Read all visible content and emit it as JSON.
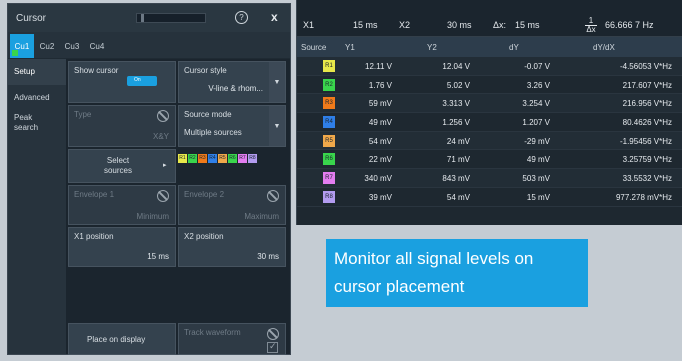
{
  "dialog": {
    "title": "Cursor",
    "help_icon": "?",
    "close_icon": "x",
    "tabs": [
      {
        "label": "Cu1"
      },
      {
        "label": "Cu2"
      },
      {
        "label": "Cu3"
      },
      {
        "label": "Cu4"
      }
    ],
    "side": [
      {
        "label": "Setup"
      },
      {
        "label": "Advanced"
      },
      {
        "label": "Peak search"
      }
    ],
    "show_cursor_label": "Show cursor",
    "show_cursor_state": "On",
    "cursor_style_label": "Cursor style",
    "cursor_style_value": "V-line & rhom...",
    "type_label": "Type",
    "type_value": "X&Y",
    "source_mode_label": "Source mode",
    "source_mode_value": "Multiple sources",
    "select_sources_label": "Select sources",
    "envelope1_label": "Envelope 1",
    "envelope1_value": "Minimum",
    "envelope2_label": "Envelope 2",
    "envelope2_value": "Maximum",
    "x1_label": "X1 position",
    "x1_value": "15 ms",
    "x2_label": "X2 position",
    "x2_value": "30 ms",
    "place_label": "Place on display",
    "track_label": "Track waveform",
    "chips": [
      {
        "t": "R1",
        "c": "#e8e84a"
      },
      {
        "t": "R2",
        "c": "#39d54c"
      },
      {
        "t": "R3",
        "c": "#f07a1a"
      },
      {
        "t": "R4",
        "c": "#2f7fe8"
      },
      {
        "t": "R5",
        "c": "#f0a84a"
      },
      {
        "t": "R6",
        "c": "#39d54c"
      },
      {
        "t": "R7",
        "c": "#e37df0"
      },
      {
        "t": "R8",
        "c": "#b39cf0"
      }
    ]
  },
  "results": {
    "x1_label": "X1",
    "x1_value": "15 ms",
    "x2_label": "X2",
    "x2_value": "30 ms",
    "dx_label": "Δx:",
    "dx_value": "15 ms",
    "inv_num": "1",
    "inv_den": "Δx",
    "inv_value": "66.666 7 Hz",
    "columns": [
      "Source",
      "Y1",
      "Y2",
      "dY",
      "dY/dX"
    ],
    "rows": [
      {
        "src": "R1",
        "color": "#e8e84a",
        "y1": "12.11 V",
        "y2": "12.04 V",
        "dy": "-0.07 V",
        "dydx": "-4.56053 V*Hz"
      },
      {
        "src": "R2",
        "color": "#39d54c",
        "y1": "1.76 V",
        "y2": "5.02 V",
        "dy": "3.26 V",
        "dydx": "217.607 V*Hz"
      },
      {
        "src": "R3",
        "color": "#f07a1a",
        "y1": "59 mV",
        "y2": "3.313 V",
        "dy": "3.254 V",
        "dydx": "216.956 V*Hz"
      },
      {
        "src": "R4",
        "color": "#2f7fe8",
        "y1": "49 mV",
        "y2": "1.256 V",
        "dy": "1.207 V",
        "dydx": "80.4626 V*Hz"
      },
      {
        "src": "R5",
        "color": "#f0a84a",
        "y1": "54 mV",
        "y2": "24 mV",
        "dy": "-29 mV",
        "dydx": "-1.95456 V*Hz"
      },
      {
        "src": "R6",
        "color": "#39d54c",
        "y1": "22 mV",
        "y2": "71 mV",
        "dy": "49 mV",
        "dydx": "3.25759 V*Hz"
      },
      {
        "src": "R7",
        "color": "#e37df0",
        "y1": "340 mV",
        "y2": "843 mV",
        "dy": "503 mV",
        "dydx": "33.5532 V*Hz"
      },
      {
        "src": "R8",
        "color": "#b39cf0",
        "y1": "39 mV",
        "y2": "54 mV",
        "dy": "15 mV",
        "dydx": "977.278 mV*Hz"
      }
    ]
  },
  "callout": {
    "text": "Monitor all signal levels on cursor placement"
  }
}
